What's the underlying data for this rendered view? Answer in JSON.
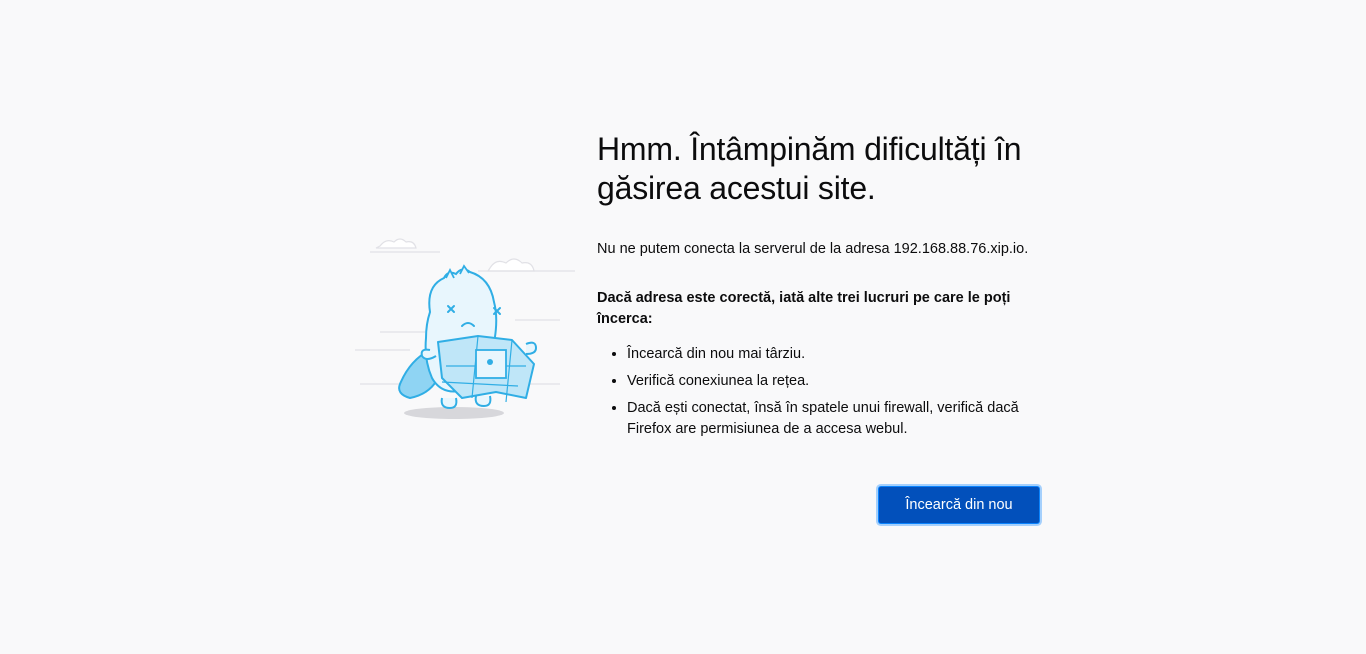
{
  "error": {
    "title": "Hmm. Întâmpinăm dificultăți în găsirea acestui site.",
    "description": "Nu ne putem conecta la serverul de la adresa 192.168.88.76.xip.io.",
    "suggestions_heading": "Dacă adresa este corectă, iată alte trei lucruri pe care le poți încerca:",
    "suggestions": [
      "Încearcă din nou mai târziu.",
      "Verifică conexiunea la rețea.",
      "Dacă ești conectat, însă în spatele unui firewall, verifică dacă Firefox are permisiunea de a accesa webul."
    ],
    "try_again_label": "Încearcă din nou"
  },
  "colors": {
    "background": "#f9f9fa",
    "button": "#0250bb",
    "illustration_accent": "#30aee5"
  },
  "icons": {
    "illustration": "lost-dino-with-map-illustration"
  }
}
